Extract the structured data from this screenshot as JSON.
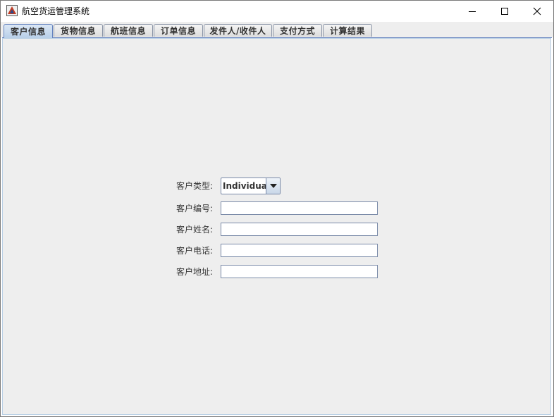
{
  "window": {
    "title": "航空货运管理系统",
    "controls": {
      "minimize": "minimize-icon",
      "maximize": "maximize-icon",
      "close": "close-icon"
    }
  },
  "tabs": [
    {
      "label": "客户信息",
      "active": true
    },
    {
      "label": "货物信息",
      "active": false
    },
    {
      "label": "航班信息",
      "active": false
    },
    {
      "label": "订单信息",
      "active": false
    },
    {
      "label": "发件人/收件人",
      "active": false
    },
    {
      "label": "支付方式",
      "active": false
    },
    {
      "label": "计算结果",
      "active": false
    }
  ],
  "form": {
    "customer_type": {
      "label": "客户类型:",
      "selected": "Individual"
    },
    "customer_id": {
      "label": "客户编号:",
      "value": ""
    },
    "customer_name": {
      "label": "客户姓名:",
      "value": ""
    },
    "customer_phone": {
      "label": "客户电话:",
      "value": ""
    },
    "customer_address": {
      "label": "客户地址:",
      "value": ""
    }
  },
  "colors": {
    "panel_bg": "#eeeeee",
    "tab_active": "#b8cfe8",
    "border_accent": "#6382be"
  }
}
